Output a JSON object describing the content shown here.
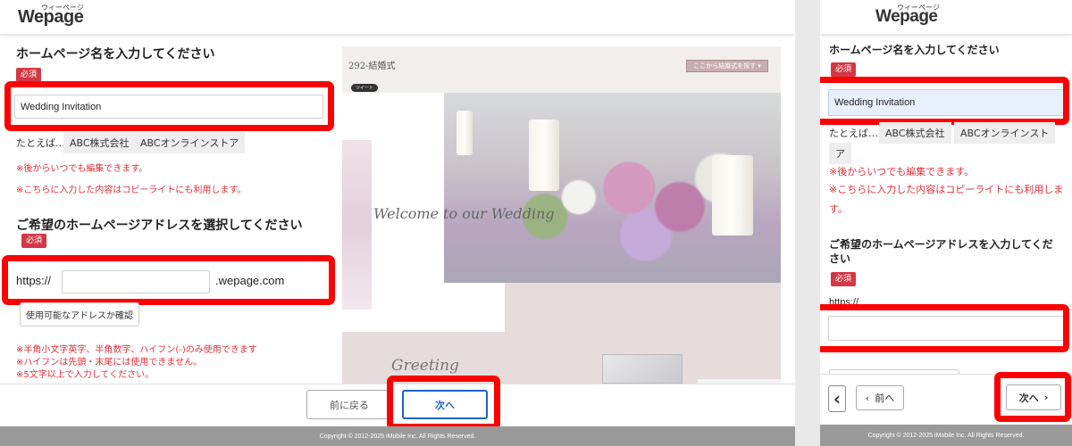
{
  "logo": {
    "text": "Wepage",
    "kana": "ウィーページ"
  },
  "desktop": {
    "name_section": {
      "heading": "ホームページ名を入力してください",
      "required": "必須",
      "input_value": "Wedding Invitation",
      "example_label": "たとえば…",
      "examples": [
        "ABC株式会社",
        "ABCオンラインストア"
      ],
      "notes": [
        "※後からいつでも編集できます。",
        "※こちらに入力した内容はコピーライトにも利用します。"
      ]
    },
    "address_section": {
      "heading": "ご希望のホームページアドレスを選択してください",
      "required": "必須",
      "prefix": "https://",
      "input_value": "",
      "suffix": ".wepage.com",
      "check_button": "使用可能なアドレスか確認",
      "notes": [
        "※半角小文字英字、半角数字、ハイフン(-)のみ使用できます",
        "※ハイフンは先頭・末尾には使用できません。",
        "※5文字以上で入力してください。"
      ]
    },
    "preview": {
      "template_title": "292-結婚式",
      "nav_label": "ここから結婚式を探す ▾",
      "tweet": "ツイート",
      "welcome_text": "Welcome to our Wedding",
      "greeting_text": "Greeting"
    },
    "footer": {
      "back": "前に戻る",
      "next": "次へ",
      "copyright": "Copyright © 2012-2025 iMobile Inc. All Rights Reserved."
    }
  },
  "mobile": {
    "name_section": {
      "heading": "ホームページ名を入力してください",
      "required": "必須",
      "input_value": "Wedding Invitation",
      "example_label": "たとえば…",
      "examples": [
        "ABC株式会社",
        "ABCオンラインスト",
        "ア"
      ],
      "notes": [
        "※後からいつでも編集できます。",
        "※こちらに入力した内容はコピーライトにも利用しま",
        "す。"
      ]
    },
    "address_section": {
      "heading_line1": "ご希望のホームページアドレスを入力してくだ",
      "heading_line2": "さい",
      "required": "必須",
      "prefix": "https://",
      "input_value": ""
    },
    "footer": {
      "back_icon": "‹",
      "prev": "前へ",
      "next": "次へ",
      "copyright": "Copyright © 2012-2025 iMobile Inc. All Rights Reserved."
    }
  },
  "colors": {
    "accent": "#1f63c6",
    "required_badge": "#d43845",
    "note_red": "#e0303a",
    "highlight_frame": "#ff0000"
  }
}
